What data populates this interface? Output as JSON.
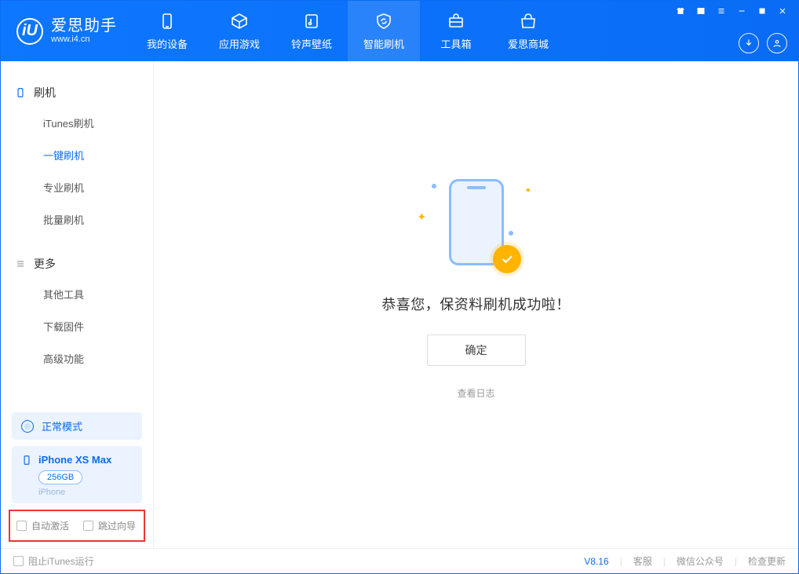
{
  "app": {
    "name_cn": "爱思助手",
    "url": "www.i4.cn",
    "logo_letter": "iU"
  },
  "nav": {
    "items": [
      {
        "label": "我的设备"
      },
      {
        "label": "应用游戏"
      },
      {
        "label": "铃声壁纸"
      },
      {
        "label": "智能刷机"
      },
      {
        "label": "工具箱"
      },
      {
        "label": "爱思商城"
      }
    ],
    "active_index": 3
  },
  "sidebar": {
    "group1": {
      "title": "刷机",
      "items": [
        {
          "label": "iTunes刷机"
        },
        {
          "label": "一键刷机"
        },
        {
          "label": "专业刷机"
        },
        {
          "label": "批量刷机"
        }
      ],
      "active_index": 1
    },
    "group2": {
      "title": "更多",
      "items": [
        {
          "label": "其他工具"
        },
        {
          "label": "下载固件"
        },
        {
          "label": "高级功能"
        }
      ]
    },
    "mode": {
      "label": "正常模式"
    },
    "device": {
      "name": "iPhone XS Max",
      "capacity": "256GB",
      "type": "iPhone"
    },
    "checks": {
      "auto_activate": "自动激活",
      "skip_guide": "跳过向导"
    }
  },
  "main": {
    "success_text": "恭喜您，保资料刷机成功啦！",
    "ok_button": "确定",
    "view_log": "查看日志"
  },
  "footer": {
    "block_itunes": "阻止iTunes运行",
    "version": "V8.16",
    "links": {
      "support": "客服",
      "wechat": "微信公众号",
      "update": "检查更新"
    }
  }
}
